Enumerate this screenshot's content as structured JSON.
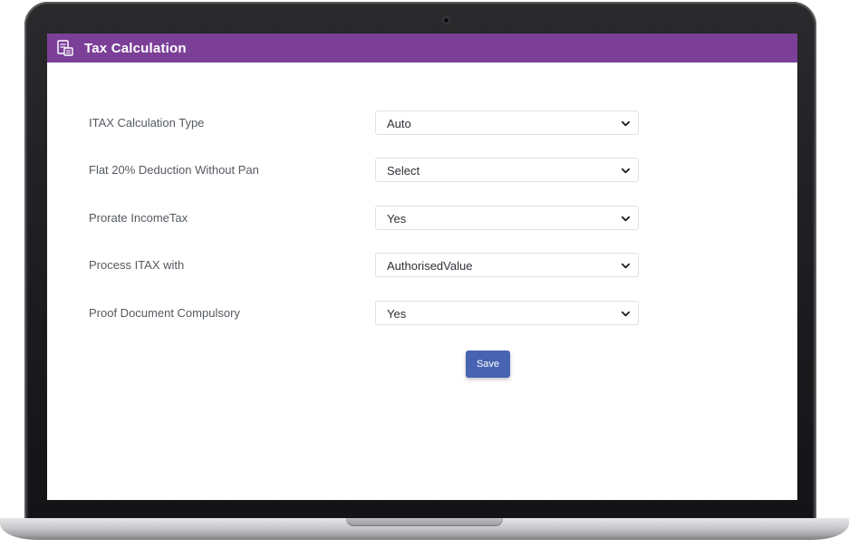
{
  "window": {
    "title": "Tax Calculation"
  },
  "form": {
    "rows": [
      {
        "label": "ITAX Calculation Type",
        "value": "Auto"
      },
      {
        "label": "Flat 20% Deduction Without Pan",
        "value": "Select"
      },
      {
        "label": "Prorate IncomeTax",
        "value": "Yes"
      },
      {
        "label": "Process ITAX with",
        "value": "AuthorisedValue"
      },
      {
        "label": "Proof Document Compulsory",
        "value": "Yes"
      }
    ],
    "save_label": "Save"
  },
  "colors": {
    "header_bg": "#7b3f98",
    "button_bg": "#4763b2"
  },
  "icons": {
    "header": "tax-document-icon",
    "dropdown": "chevron-down-icon"
  }
}
